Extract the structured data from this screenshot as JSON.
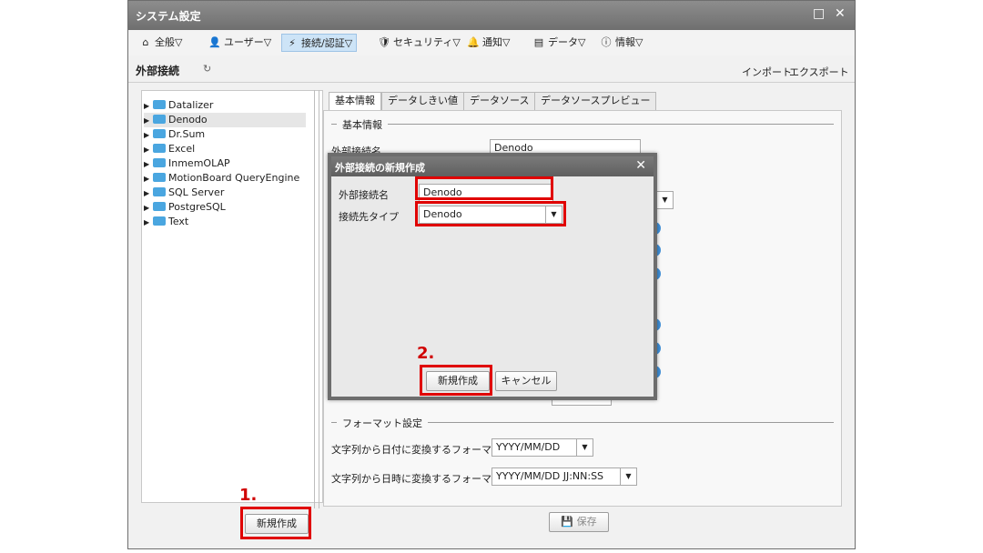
{
  "window": {
    "title": "システム設定",
    "controls": {
      "maximize": "□",
      "close": "✕"
    }
  },
  "menu": {
    "items": [
      {
        "icon": "home-icon",
        "glyph": "⌂",
        "label": "全般▽"
      },
      {
        "icon": "user-icon",
        "glyph": "👤",
        "label": "ユーザー▽"
      },
      {
        "icon": "plug-icon",
        "glyph": "⚡",
        "label": "接続/認証▽",
        "active": true
      },
      {
        "icon": "shield-icon",
        "glyph": "🛡",
        "label": "セキュリティ▽"
      },
      {
        "icon": "bell-icon",
        "glyph": "🔔",
        "label": "通知▽"
      },
      {
        "icon": "data-icon",
        "glyph": "▤",
        "label": "データ▽"
      },
      {
        "icon": "info-icon",
        "glyph": "ⓘ",
        "label": "情報▽"
      }
    ]
  },
  "subheader": {
    "title": "外部接続",
    "reload_icon": "↻",
    "import": "インポート",
    "export": "エクスポート"
  },
  "tree": {
    "items": [
      {
        "label": "Datalizer"
      },
      {
        "label": "Denodo",
        "selected": true
      },
      {
        "label": "Dr.Sum"
      },
      {
        "label": "Excel"
      },
      {
        "label": "InmemOLAP"
      },
      {
        "label": "MotionBoard QueryEngine"
      },
      {
        "label": "SQL Server"
      },
      {
        "label": "PostgreSQL"
      },
      {
        "label": "Text"
      }
    ],
    "expand_glyph": "▶"
  },
  "left_button": {
    "label": "新規作成"
  },
  "tabs": [
    {
      "label": "基本情報",
      "active": true
    },
    {
      "label": "データしきい値"
    },
    {
      "label": "データソース"
    },
    {
      "label": "データソースプレビュー"
    }
  ],
  "basic": {
    "section_title": "基本情報",
    "name_label": "外部接続名",
    "name_value": "Denodo"
  },
  "format": {
    "section_title": "フォーマット設定",
    "date_label": "文字列から日付に変換するフォーマット",
    "date_value": "YYYY/MM/DD",
    "datetime_label": "文字列から日時に変換するフォーマット",
    "datetime_value": "YYYY/MM/DD JJ:NN:SS"
  },
  "save_button": {
    "icon": "💾",
    "label": "保存"
  },
  "dialog": {
    "title": "外部接続の新規作成",
    "close": "✕",
    "name_label": "外部接続名",
    "name_value": "Denodo",
    "type_label": "接続先タイプ",
    "type_value": "Denodo",
    "create_button": "新規作成",
    "cancel_button": "キャンセル"
  },
  "annotations": {
    "step1": "1.",
    "step2": "2.",
    "highlight_color": "#e00000"
  },
  "dropdown_glyph": "▼"
}
